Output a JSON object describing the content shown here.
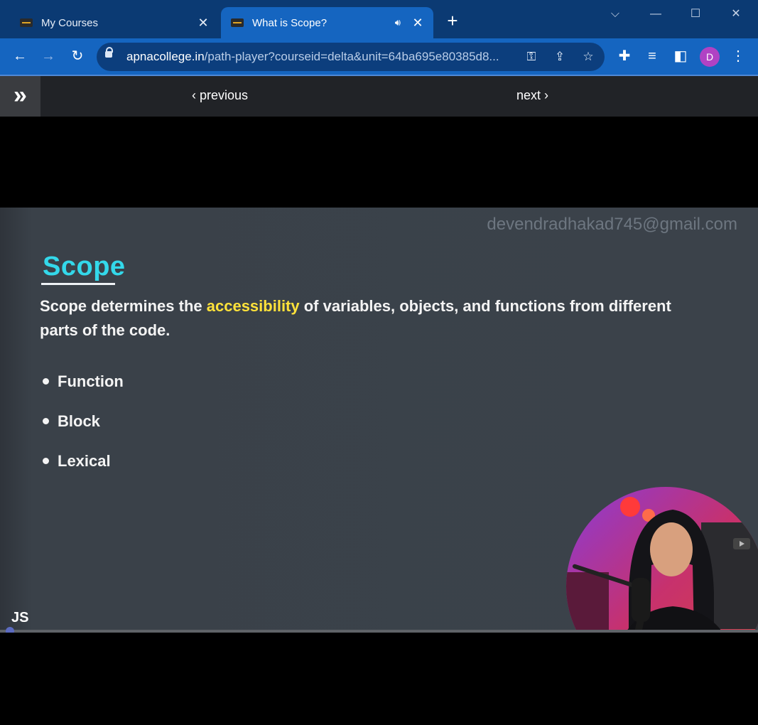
{
  "tabs": [
    {
      "title": "My Courses",
      "active": false
    },
    {
      "title": "What is Scope?",
      "active": true
    }
  ],
  "toolbar": {
    "url_host": "apnacollege.in",
    "url_path": "/path-player?courseid=delta&unit=64ba695e80385d8...",
    "avatar_letter": "D"
  },
  "sitenav": {
    "previous_label": "previous",
    "next_label": "next"
  },
  "slide": {
    "watermark": "devendradhakad745@gmail.com",
    "title": "Scope",
    "text_before": "Scope determines the ",
    "text_highlight": "accessibility",
    "text_after": " of variables, objects, and functions from different parts of the code.",
    "bullets": [
      "Function",
      "Block",
      "Lexical"
    ],
    "corner_label": "JS"
  },
  "video": {
    "progress": 0.005
  },
  "colors": {
    "tabbar": "#0b3a73",
    "toolbar": "#1565c0",
    "title_accent": "#33d8ea",
    "highlight": "#ffe23a"
  }
}
